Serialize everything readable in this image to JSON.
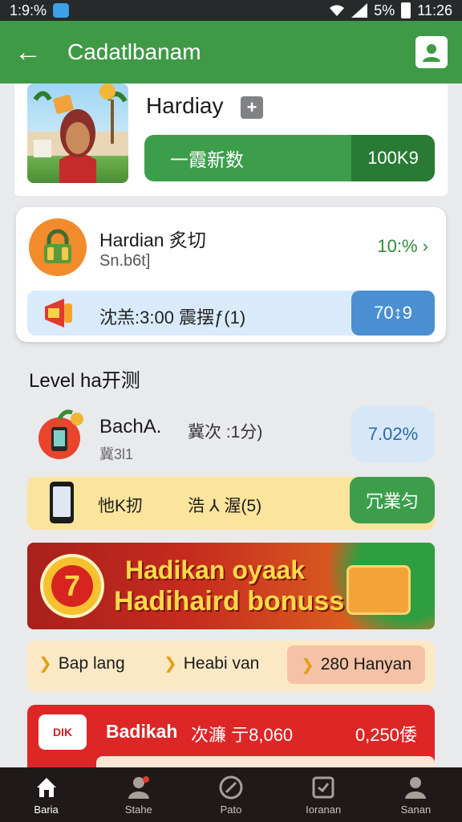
{
  "status_bar": {
    "time": "1:9:%",
    "battery": "5%",
    "clock": "11:26"
  },
  "app_bar": {
    "title": "Cadatlbanam"
  },
  "profile": {
    "name": "Hardiay",
    "add_symbol": "+",
    "progress_label": "一霞新数",
    "progress_value": "100K9"
  },
  "task_card": {
    "title": "Hardian 炙切",
    "subtitle": "Sn.b6t]",
    "percent": "10:% ›",
    "row_label": "沈羔:3:00   震摆ƒ(1)",
    "row_button": "70↕9"
  },
  "level_section": {
    "heading": "Level ha开测"
  },
  "level_item": {
    "name": "BachA.",
    "sub": "冀3l1",
    "middle": "冀次 :1分)",
    "percent": "7.02%"
  },
  "yellow_row": {
    "label": "忚K扨",
    "middle": "浩 ⅄ 渥(5)",
    "button": "冗業匀"
  },
  "banner": {
    "line1": "Hadikan oyaak",
    "line2": "Hadihaird bonuss",
    "badge": "7"
  },
  "tags": [
    {
      "label": "Bap lang"
    },
    {
      "label": "Heabi van"
    },
    {
      "label": "280 Hanyan"
    }
  ],
  "red_row": {
    "logo": "DIK",
    "title": "Badikah",
    "sub": "次濂 亍8,060",
    "amount": "0,250倭"
  },
  "bottom_nav": [
    {
      "label": "Baria",
      "icon": "home-icon",
      "active": true
    },
    {
      "label": "Stahe",
      "icon": "person-icon",
      "active": false
    },
    {
      "label": "Pato",
      "icon": "compass-icon",
      "active": false
    },
    {
      "label": "Ioranan",
      "icon": "task-icon",
      "active": false
    },
    {
      "label": "Sanan",
      "icon": "profile-icon",
      "active": false
    }
  ]
}
